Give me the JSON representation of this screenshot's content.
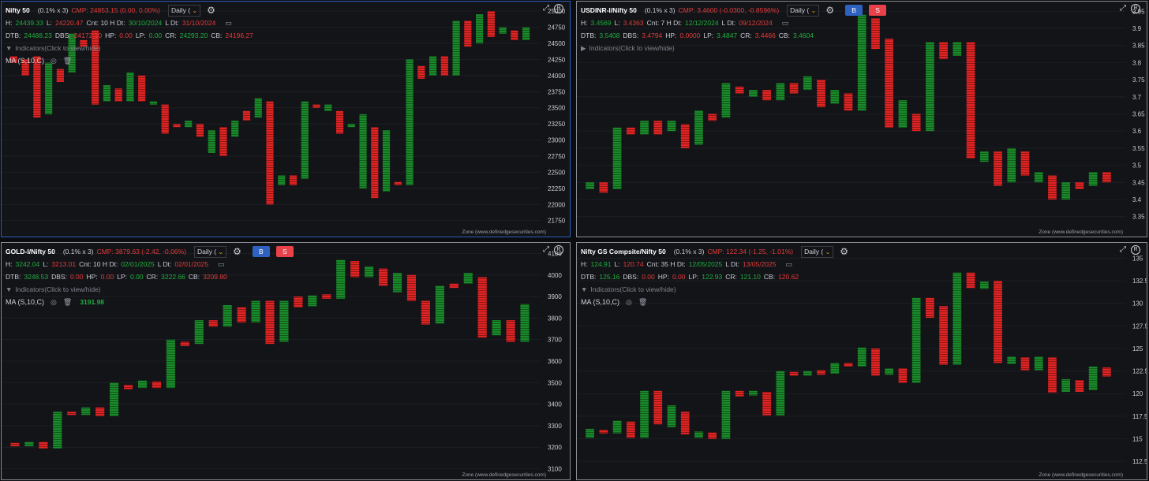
{
  "panels": [
    {
      "symbol": "Nifty 50",
      "box": "(0.1% x 3)",
      "cmp": "CMP: 24853.15 (0.00, 0.00%)",
      "timeframe": "Daily (",
      "h_label": "H:",
      "h": "24439.33",
      "l_label": "L:",
      "l": "24220.47",
      "cnt": "Cnt: 10 H Dt:",
      "hdt": "30/10/2024",
      "ldt_label": "L Dt:",
      "ldt": "31/10/2024",
      "dtb_label": "DTB:",
      "dtb": "24488.23",
      "dbs_label": "DBS:",
      "dbs": "24172.10",
      "hp_label": "HP:",
      "hp": "0.00",
      "lp_label": "LP:",
      "lp": "0.00",
      "cr_label": "CR:",
      "cr": "24293.20",
      "cb_label": "CB:",
      "cb": "24196.27",
      "indicators": "Indicators(Click to view/hide)",
      "ma": "MA (S,10,C)",
      "ma_value": "",
      "zone": "Zone (www.definedgesecurities.com)"
    },
    {
      "symbol": "USDINR-I/Nifty 50",
      "box": "(0.1% x 3)",
      "cmp": "CMP: 3.4600 (-0.0300, -0.8596%)",
      "timeframe": "Daily (",
      "buy": "B",
      "sell": "S",
      "h_label": "H:",
      "h": "3.4569",
      "l_label": "L:",
      "l": "3.4363",
      "cnt": "Cnt: 7 H Dt:",
      "hdt": "12/12/2024",
      "ldt_label": "L Dt:",
      "ldt": "09/12/2024",
      "dtb_label": "DTB:",
      "dtb": "3.5408",
      "dbs_label": "DBS:",
      "dbs": "3.4794",
      "hp_label": "HP:",
      "hp": "0.0000",
      "lp_label": "LP:",
      "lp": "3.4847",
      "cr_label": "CR:",
      "cr": "3.4466",
      "cb_label": "CB:",
      "cb": "3.4604",
      "indicators": "Indicators(Click to view/hide)",
      "zone": "Zone (www.definedgesecurities.com)"
    },
    {
      "symbol": "GOLD-I/Nifty 50",
      "box": "(0.1% x 3)",
      "cmp": "CMP: 3879.63 (-2.42, -0.06%)",
      "timeframe": "Daily (",
      "buy": "B",
      "sell": "S",
      "h_label": "H:",
      "h": "3242.04",
      "l_label": "L:",
      "l": "3213.01",
      "cnt": "Cnt: 10 H Dt:",
      "hdt": "02/01/2025",
      "ldt_label": "L Dt:",
      "ldt": "02/01/2025",
      "dtb_label": "DTB:",
      "dtb": "3248.53",
      "dbs_label": "DBS:",
      "dbs": "0.00",
      "hp_label": "HP:",
      "hp": "0.00",
      "lp_label": "LP:",
      "lp": "0.00",
      "cr_label": "CR:",
      "cr": "3222.66",
      "cb_label": "CB:",
      "cb": "3209.80",
      "indicators": "Indicators(Click to view/hide)",
      "ma": "MA (S,10,C)",
      "ma_value": "3191.98",
      "zone": "Zone (www.definedgesecurities.com)"
    },
    {
      "symbol": "Nifty GS Compsite/Nifty 50",
      "box": "(0.1% x 3)",
      "cmp": "CMP: 122.34 (-1.25, -1.01%)",
      "timeframe": "Daily (",
      "h_label": "H:",
      "h": "124.91",
      "l_label": "L:",
      "l": "120.74",
      "cnt": "Cnt: 35 H Dt:",
      "hdt": "12/05/2025",
      "ldt_label": "L Dt:",
      "ldt": "13/05/2025",
      "dtb_label": "DTB:",
      "dtb": "125.16",
      "dbs_label": "DBS:",
      "dbs": "0.00",
      "hp_label": "HP:",
      "hp": "0.00",
      "lp_label": "LP:",
      "lp": "122.93",
      "cr_label": "CR:",
      "cr": "121.10",
      "cb_label": "CB:",
      "cb": "120.62",
      "indicators": "Indicators(Click to view/hide)",
      "ma": "MA (S,10,C)",
      "ma_value": "",
      "zone": "Zone (www.definedgesecurities.com)"
    }
  ],
  "colors": {
    "up": "#1a8a2a",
    "down": "#e02424",
    "background": "#131418",
    "grid": "#1c1e24"
  },
  "chart_data": [
    {
      "type": "point-and-figure",
      "title": "Nifty 50",
      "ylim": [
        21600,
        25050
      ],
      "yticks": [
        21750,
        22000,
        22250,
        22500,
        22750,
        23000,
        23250,
        23500,
        23750,
        24000,
        24250,
        24500,
        24750,
        25000
      ],
      "columns": [
        {
          "dir": "down",
          "high": 24300,
          "low": 24200
        },
        {
          "dir": "down",
          "high": 24250,
          "low": 24000
        },
        {
          "dir": "down",
          "high": 24300,
          "low": 23350
        },
        {
          "dir": "up",
          "high": 24200,
          "low": 23400
        },
        {
          "dir": "down",
          "high": 24100,
          "low": 23900
        },
        {
          "dir": "up",
          "high": 24650,
          "low": 24050
        },
        {
          "dir": "down",
          "high": 24550,
          "low": 24450
        },
        {
          "dir": "down",
          "high": 24700,
          "low": 23550
        },
        {
          "dir": "up",
          "high": 23850,
          "low": 23600
        },
        {
          "dir": "down",
          "high": 23800,
          "low": 23600
        },
        {
          "dir": "up",
          "high": 24050,
          "low": 23600
        },
        {
          "dir": "down",
          "high": 24000,
          "low": 23600
        },
        {
          "dir": "up",
          "high": 23600,
          "low": 23550
        },
        {
          "dir": "down",
          "high": 23550,
          "low": 23100
        },
        {
          "dir": "down",
          "high": 23250,
          "low": 23200
        },
        {
          "dir": "up",
          "high": 23300,
          "low": 23200
        },
        {
          "dir": "down",
          "high": 23250,
          "low": 23050
        },
        {
          "dir": "up",
          "high": 23150,
          "low": 22800
        },
        {
          "dir": "down",
          "high": 23200,
          "low": 22750
        },
        {
          "dir": "up",
          "high": 23300,
          "low": 23050
        },
        {
          "dir": "down",
          "high": 23450,
          "low": 23300
        },
        {
          "dir": "up",
          "high": 23650,
          "low": 23350
        },
        {
          "dir": "down",
          "high": 23600,
          "low": 22000
        },
        {
          "dir": "up",
          "high": 22450,
          "low": 22300
        },
        {
          "dir": "down",
          "high": 22450,
          "low": 22300
        },
        {
          "dir": "up",
          "high": 23600,
          "low": 22400
        },
        {
          "dir": "down",
          "high": 23550,
          "low": 23500
        },
        {
          "dir": "up",
          "high": 23550,
          "low": 23450
        },
        {
          "dir": "down",
          "high": 23450,
          "low": 23100
        },
        {
          "dir": "up",
          "high": 23250,
          "low": 23200
        },
        {
          "dir": "up",
          "high": 23400,
          "low": 22250
        },
        {
          "dir": "down",
          "high": 23200,
          "low": 22100
        },
        {
          "dir": "up",
          "high": 23150,
          "low": 22200
        },
        {
          "dir": "down",
          "high": 22350,
          "low": 22300
        },
        {
          "dir": "up",
          "high": 24250,
          "low": 22300
        },
        {
          "dir": "down",
          "high": 24150,
          "low": 23950
        },
        {
          "dir": "up",
          "high": 24300,
          "low": 24000
        },
        {
          "dir": "down",
          "high": 24300,
          "low": 24000
        },
        {
          "dir": "up",
          "high": 24850,
          "low": 24000
        },
        {
          "dir": "down",
          "high": 24850,
          "low": 24450
        },
        {
          "dir": "up",
          "high": 24950,
          "low": 24500
        },
        {
          "dir": "down",
          "high": 25000,
          "low": 24600
        },
        {
          "dir": "up",
          "high": 24750,
          "low": 24650
        },
        {
          "dir": "down",
          "high": 24700,
          "low": 24550
        },
        {
          "dir": "up",
          "high": 24750,
          "low": 24550
        }
      ]
    },
    {
      "type": "point-and-figure",
      "title": "USDINR-I/Nifty 50",
      "ylim": [
        3.31,
        3.96
      ],
      "yticks": [
        3.35,
        3.4,
        3.45,
        3.5,
        3.55,
        3.6,
        3.65,
        3.7,
        3.75,
        3.8,
        3.85,
        3.9,
        3.95
      ],
      "columns": [
        {
          "dir": "up",
          "high": 3.45,
          "low": 3.43
        },
        {
          "dir": "down",
          "high": 3.45,
          "low": 3.42
        },
        {
          "dir": "up",
          "high": 3.61,
          "low": 3.43
        },
        {
          "dir": "down",
          "high": 3.61,
          "low": 3.59
        },
        {
          "dir": "up",
          "high": 3.63,
          "low": 3.59
        },
        {
          "dir": "down",
          "high": 3.63,
          "low": 3.59
        },
        {
          "dir": "up",
          "high": 3.63,
          "low": 3.6
        },
        {
          "dir": "down",
          "high": 3.62,
          "low": 3.55
        },
        {
          "dir": "up",
          "high": 3.66,
          "low": 3.56
        },
        {
          "dir": "down",
          "high": 3.65,
          "low": 3.63
        },
        {
          "dir": "up",
          "high": 3.74,
          "low": 3.64
        },
        {
          "dir": "down",
          "high": 3.73,
          "low": 3.71
        },
        {
          "dir": "up",
          "high": 3.72,
          "low": 3.7
        },
        {
          "dir": "down",
          "high": 3.72,
          "low": 3.69
        },
        {
          "dir": "up",
          "high": 3.74,
          "low": 3.69
        },
        {
          "dir": "down",
          "high": 3.74,
          "low": 3.71
        },
        {
          "dir": "up",
          "high": 3.76,
          "low": 3.72
        },
        {
          "dir": "down",
          "high": 3.75,
          "low": 3.67
        },
        {
          "dir": "up",
          "high": 3.72,
          "low": 3.68
        },
        {
          "dir": "down",
          "high": 3.71,
          "low": 3.66
        },
        {
          "dir": "up",
          "high": 3.94,
          "low": 3.66
        },
        {
          "dir": "down",
          "high": 3.93,
          "low": 3.84
        },
        {
          "dir": "down",
          "high": 3.87,
          "low": 3.61
        },
        {
          "dir": "up",
          "high": 3.69,
          "low": 3.61
        },
        {
          "dir": "down",
          "high": 3.65,
          "low": 3.6
        },
        {
          "dir": "up",
          "high": 3.86,
          "low": 3.6
        },
        {
          "dir": "down",
          "high": 3.86,
          "low": 3.81
        },
        {
          "dir": "up",
          "high": 3.86,
          "low": 3.82
        },
        {
          "dir": "down",
          "high": 3.86,
          "low": 3.52
        },
        {
          "dir": "up",
          "high": 3.54,
          "low": 3.51
        },
        {
          "dir": "down",
          "high": 3.54,
          "low": 3.44
        },
        {
          "dir": "up",
          "high": 3.55,
          "low": 3.45
        },
        {
          "dir": "down",
          "high": 3.54,
          "low": 3.47
        },
        {
          "dir": "up",
          "high": 3.48,
          "low": 3.45
        },
        {
          "dir": "down",
          "high": 3.47,
          "low": 3.4
        },
        {
          "dir": "up",
          "high": 3.45,
          "low": 3.4
        },
        {
          "dir": "down",
          "high": 3.45,
          "low": 3.43
        },
        {
          "dir": "up",
          "high": 3.48,
          "low": 3.44
        },
        {
          "dir": "down",
          "high": 3.48,
          "low": 3.45
        }
      ]
    },
    {
      "type": "point-and-figure",
      "title": "GOLD-I/Nifty 50",
      "ylim": [
        3080,
        4120
      ],
      "yticks": [
        3100,
        3200,
        3300,
        3400,
        3500,
        3600,
        3700,
        3800,
        3900,
        4000,
        4100
      ],
      "columns": [
        {
          "dir": "down",
          "high": 3220,
          "low": 3205
        },
        {
          "dir": "up",
          "high": 3225,
          "low": 3205
        },
        {
          "dir": "down",
          "high": 3225,
          "low": 3195
        },
        {
          "dir": "up",
          "high": 3365,
          "low": 3195
        },
        {
          "dir": "down",
          "high": 3365,
          "low": 3350
        },
        {
          "dir": "up",
          "high": 3385,
          "low": 3350
        },
        {
          "dir": "down",
          "high": 3385,
          "low": 3345
        },
        {
          "dir": "up",
          "high": 3500,
          "low": 3345
        },
        {
          "dir": "down",
          "high": 3490,
          "low": 3470
        },
        {
          "dir": "up",
          "high": 3510,
          "low": 3475
        },
        {
          "dir": "down",
          "high": 3505,
          "low": 3475
        },
        {
          "dir": "up",
          "high": 3700,
          "low": 3475
        },
        {
          "dir": "down",
          "high": 3690,
          "low": 3670
        },
        {
          "dir": "up",
          "high": 3790,
          "low": 3680
        },
        {
          "dir": "down",
          "high": 3790,
          "low": 3760
        },
        {
          "dir": "up",
          "high": 3860,
          "low": 3760
        },
        {
          "dir": "down",
          "high": 3850,
          "low": 3780
        },
        {
          "dir": "up",
          "high": 3880,
          "low": 3780
        },
        {
          "dir": "down",
          "high": 3880,
          "low": 3680
        },
        {
          "dir": "up",
          "high": 3880,
          "low": 3690
        },
        {
          "dir": "down",
          "high": 3900,
          "low": 3850
        },
        {
          "dir": "up",
          "high": 3905,
          "low": 3855
        },
        {
          "dir": "down",
          "high": 3910,
          "low": 3890
        },
        {
          "dir": "up",
          "high": 4070,
          "low": 3890
        },
        {
          "dir": "down",
          "high": 4065,
          "low": 3990
        },
        {
          "dir": "up",
          "high": 4040,
          "low": 3990
        },
        {
          "dir": "down",
          "high": 4030,
          "low": 3950
        },
        {
          "dir": "up",
          "high": 4010,
          "low": 3920
        },
        {
          "dir": "down",
          "high": 4000,
          "low": 3880
        },
        {
          "dir": "down",
          "high": 3880,
          "low": 3770
        },
        {
          "dir": "up",
          "high": 3950,
          "low": 3775
        },
        {
          "dir": "down",
          "high": 3960,
          "low": 3940
        },
        {
          "dir": "up",
          "high": 4010,
          "low": 3960
        },
        {
          "dir": "down",
          "high": 3990,
          "low": 3710
        },
        {
          "dir": "up",
          "high": 3790,
          "low": 3720
        },
        {
          "dir": "down",
          "high": 3790,
          "low": 3690
        },
        {
          "dir": "up",
          "high": 3865,
          "low": 3690
        }
      ]
    },
    {
      "type": "point-and-figure",
      "title": "Nifty GS Compsite/Nifty 50",
      "ylim": [
        111.2,
        136
      ],
      "yticks": [
        112.5,
        115,
        117.5,
        120,
        122.5,
        125,
        127.5,
        130,
        132.5,
        135
      ],
      "columns": [
        {
          "dir": "up",
          "high": 116.1,
          "low": 115.1
        },
        {
          "dir": "down",
          "high": 116.0,
          "low": 115.6
        },
        {
          "dir": "up",
          "high": 117.0,
          "low": 115.6
        },
        {
          "dir": "down",
          "high": 116.9,
          "low": 115.1
        },
        {
          "dir": "up",
          "high": 120.3,
          "low": 115.1
        },
        {
          "dir": "down",
          "high": 120.3,
          "low": 116.6
        },
        {
          "dir": "up",
          "high": 118.7,
          "low": 116.3
        },
        {
          "dir": "down",
          "high": 118.0,
          "low": 115.5
        },
        {
          "dir": "up",
          "high": 115.8,
          "low": 115.1
        },
        {
          "dir": "down",
          "high": 115.7,
          "low": 115.0
        },
        {
          "dir": "up",
          "high": 120.3,
          "low": 115.0
        },
        {
          "dir": "down",
          "high": 120.3,
          "low": 119.7
        },
        {
          "dir": "up",
          "high": 120.3,
          "low": 119.8
        },
        {
          "dir": "down",
          "high": 120.2,
          "low": 117.6
        },
        {
          "dir": "up",
          "high": 122.5,
          "low": 117.6
        },
        {
          "dir": "down",
          "high": 122.4,
          "low": 122.0
        },
        {
          "dir": "up",
          "high": 122.5,
          "low": 122.0
        },
        {
          "dir": "down",
          "high": 122.6,
          "low": 122.1
        },
        {
          "dir": "up",
          "high": 123.4,
          "low": 122.2
        },
        {
          "dir": "down",
          "high": 123.4,
          "low": 123.0
        },
        {
          "dir": "up",
          "high": 125.1,
          "low": 123.0
        },
        {
          "dir": "down",
          "high": 125.0,
          "low": 122.0
        },
        {
          "dir": "up",
          "high": 122.8,
          "low": 122.1
        },
        {
          "dir": "down",
          "high": 122.8,
          "low": 121.2
        },
        {
          "dir": "up",
          "high": 130.6,
          "low": 121.2
        },
        {
          "dir": "down",
          "high": 130.6,
          "low": 128.4
        },
        {
          "dir": "down",
          "high": 129.7,
          "low": 123.2
        },
        {
          "dir": "up",
          "high": 133.4,
          "low": 123.2
        },
        {
          "dir": "down",
          "high": 133.4,
          "low": 131.7
        },
        {
          "dir": "up",
          "high": 132.4,
          "low": 131.6
        },
        {
          "dir": "down",
          "high": 132.5,
          "low": 123.4
        },
        {
          "dir": "up",
          "high": 124.1,
          "low": 123.3
        },
        {
          "dir": "down",
          "high": 124.0,
          "low": 122.6
        },
        {
          "dir": "up",
          "high": 124.1,
          "low": 122.6
        },
        {
          "dir": "down",
          "high": 124.0,
          "low": 120.1
        },
        {
          "dir": "up",
          "high": 121.6,
          "low": 120.2
        },
        {
          "dir": "down",
          "high": 121.5,
          "low": 120.2
        },
        {
          "dir": "up",
          "high": 123.0,
          "low": 120.4
        },
        {
          "dir": "down",
          "high": 122.9,
          "low": 121.9
        }
      ]
    }
  ]
}
